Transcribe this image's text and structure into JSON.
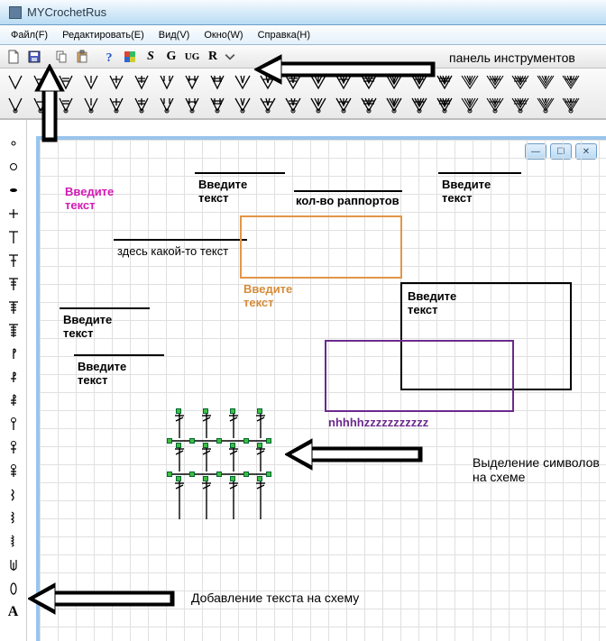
{
  "title": "MYCrochetRus",
  "menus": {
    "file": "Файл(F)",
    "edit": "Редактировать(E)",
    "view": "Вид(V)",
    "window": "Окно(W)",
    "help": "Справка(H)"
  },
  "toolbar": {
    "s": "S",
    "g": "G",
    "ug": "UG",
    "r": "R"
  },
  "annotations": {
    "panel": "панель инструментов",
    "select_symbols": "Выделение символов",
    "on_scheme": "на схеме",
    "add_text": "Добавление текста на схему"
  },
  "canvas": {
    "enter_text": "Введите",
    "enter_text2": "текст",
    "rapport": "кол-во раппортов",
    "sometext": "здесь какой-то текст",
    "nhz": "nhhhhzzzzzzzzzzz"
  },
  "lefttools": {
    "a": "A"
  }
}
